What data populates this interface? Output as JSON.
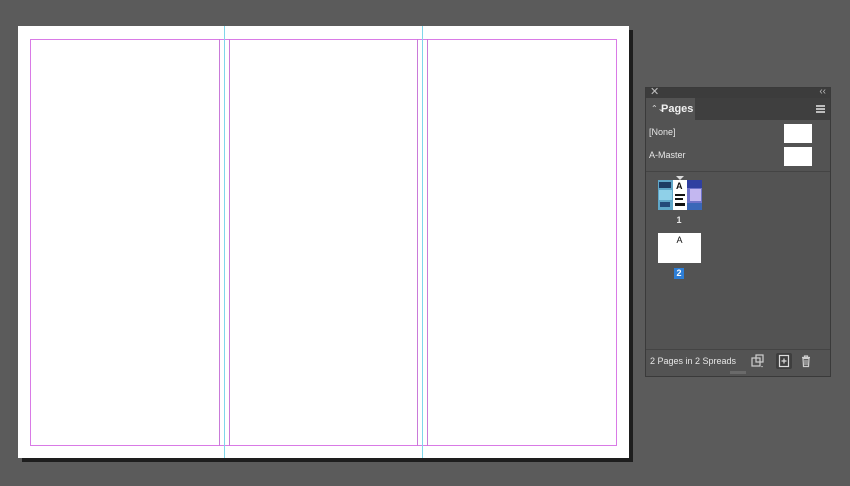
{
  "panel": {
    "close_glyph": "✕",
    "collapse_glyph": "‹‹",
    "tab_label": "Pages",
    "tab_updown_glyph": "⌃⌄",
    "menu_icon": "panel-menu-icon"
  },
  "masters": [
    {
      "label": "[None]"
    },
    {
      "label": "A-Master"
    }
  ],
  "pages": [
    {
      "number": "1",
      "master_letter": "A"
    },
    {
      "number": "2",
      "master_letter": "A",
      "selected": true
    }
  ],
  "footer": {
    "status": "2 Pages in 2 Spreads",
    "icons": [
      "edit-page-size-icon",
      "new-page-icon",
      "trash-icon"
    ]
  },
  "colors": {
    "pasteboard": "#5b5b5b",
    "margin_guide": "#d97ae6",
    "column_guide": "#7fd6ea",
    "selection": "#2d7ed6"
  }
}
